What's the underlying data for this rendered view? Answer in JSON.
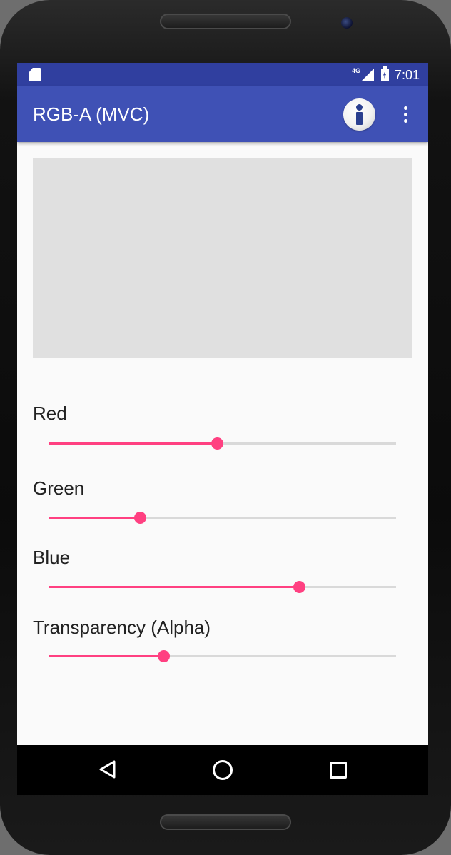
{
  "status_bar": {
    "network_label": "4G",
    "time": "7:01"
  },
  "app_bar": {
    "title": "RGB-A (MVC)",
    "info_icon": "info-icon",
    "overflow_icon": "more-vert-icon"
  },
  "sliders": [
    {
      "label": "Red",
      "value": 0.485
    },
    {
      "label": "Green",
      "value": 0.263
    },
    {
      "label": "Blue",
      "value": 0.72
    },
    {
      "label": "Transparency (Alpha)",
      "value": 0.33
    }
  ],
  "colors": {
    "status_bar": "#303f9f",
    "app_bar": "#3f51b5",
    "accent": "#ff4081",
    "preview": "#e0e0e0"
  },
  "nav_bar": {
    "back_icon": "back-icon",
    "home_icon": "home-icon",
    "recents_icon": "recents-icon"
  }
}
